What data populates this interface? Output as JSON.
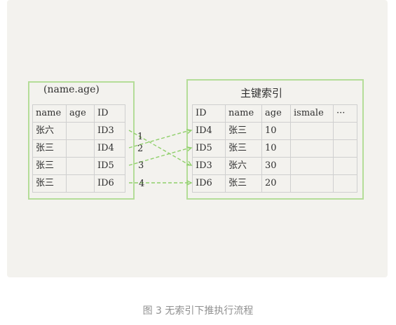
{
  "left_index": {
    "title": "(name.age)",
    "headers": [
      "name",
      "age",
      "ID"
    ],
    "rows": [
      [
        "张六",
        "",
        "ID3"
      ],
      [
        "张三",
        "",
        "ID4"
      ],
      [
        "张三",
        "",
        "ID5"
      ],
      [
        "张三",
        "",
        "ID6"
      ]
    ]
  },
  "primary_index": {
    "title": "主键索引",
    "headers": [
      "ID",
      "name",
      "age",
      "ismale",
      "···"
    ],
    "rows": [
      [
        "ID4",
        "张三",
        "10",
        "",
        ""
      ],
      [
        "ID5",
        "张三",
        "10",
        "",
        ""
      ],
      [
        "ID3",
        "张六",
        "30",
        "",
        ""
      ],
      [
        "ID6",
        "张三",
        "20",
        "",
        ""
      ]
    ]
  },
  "arrows": [
    {
      "label": "1",
      "from_row": 0,
      "to_row": 2
    },
    {
      "label": "2",
      "from_row": 1,
      "to_row": 0
    },
    {
      "label": "3",
      "from_row": 2,
      "to_row": 1
    },
    {
      "label": "4",
      "from_row": 3,
      "to_row": 3
    }
  ],
  "caption": "图 3 无索引下推执行流程",
  "colors": {
    "box_border": "#b4dd98",
    "arrow": "#8fcf6a",
    "panel": "#f3f2ee"
  }
}
